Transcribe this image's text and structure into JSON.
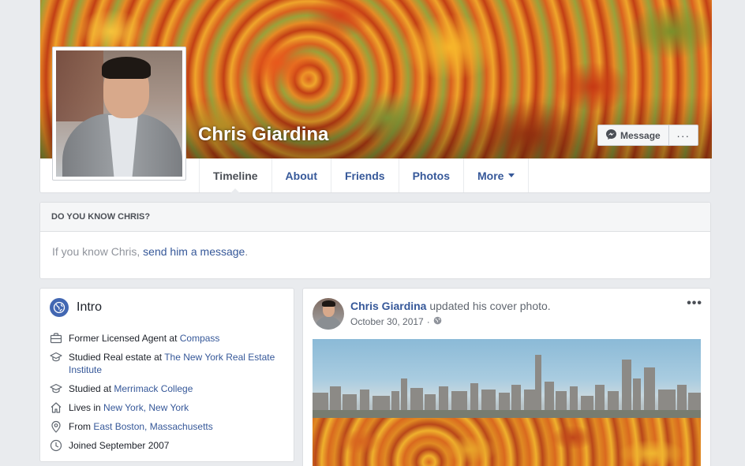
{
  "profile": {
    "name": "Chris Giardina",
    "message_button": "Message",
    "more_button": "···"
  },
  "tabs": [
    {
      "label": "Timeline",
      "active": true
    },
    {
      "label": "About"
    },
    {
      "label": "Friends"
    },
    {
      "label": "Photos"
    },
    {
      "label": "More"
    }
  ],
  "know": {
    "heading": "DO YOU KNOW CHRIS?",
    "text_before": "If you know Chris, ",
    "link": "send him a message",
    "text_after": "."
  },
  "intro": {
    "title": "Intro",
    "items": [
      {
        "icon": "briefcase-icon",
        "text": "Former Licensed Agent at ",
        "link": "Compass"
      },
      {
        "icon": "graduation-cap-icon",
        "text": "Studied Real estate at ",
        "link": "The New York Real Estate Institute"
      },
      {
        "icon": "graduation-cap-icon",
        "text": "Studied at ",
        "link": "Merrimack College"
      },
      {
        "icon": "home-icon",
        "text": "Lives in ",
        "link": "New York, New York"
      },
      {
        "icon": "location-pin-icon",
        "text": "From ",
        "link": "East Boston, Massachusetts"
      },
      {
        "icon": "clock-icon",
        "text": "Joined September 2007",
        "link": ""
      }
    ]
  },
  "post": {
    "author": "Chris Giardina",
    "action": " updated his cover photo.",
    "date": "October 30, 2017",
    "separator": "·",
    "menu": "•••"
  },
  "colors": {
    "link": "#365899",
    "brand": "#4267b2",
    "page_bg": "#e9ebee"
  }
}
